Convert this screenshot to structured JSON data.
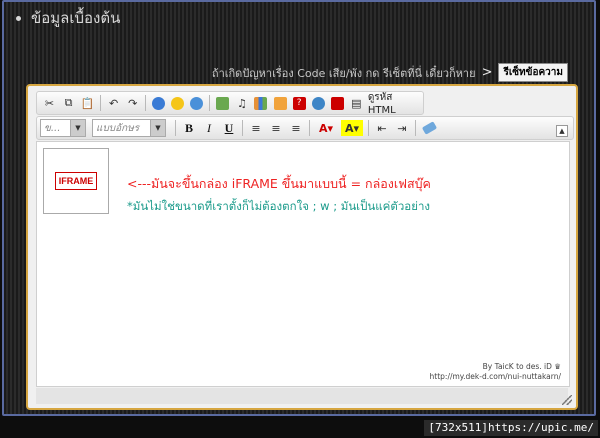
{
  "section_heading": "ข้อมูลเบื้องต้น",
  "help": {
    "text": "ถ้าเกิดปัญหาเรื่อง Code เสีย/พัง กด รีเซ็ตที่นี่ เดี๋ยวก็หาย",
    "arrow": ">",
    "reset_label": "รีเซ็ทข้อความ"
  },
  "toolbar": {
    "source_label": "ดูรหัส HTML",
    "size_placeholder": "ข...",
    "font_placeholder": "แบบอักษร",
    "bold": "B",
    "italic": "I",
    "underline": "U"
  },
  "content": {
    "iframe_label": "IFRAME",
    "line1": "<---มันจะขึ้นกล่อง iFRAME ขึ้นมาแบบนี้ = กล่องเฟสบุ๊ค",
    "line2": "*มันไม่ใช่ขนาดที่เราตั้งก็ไม่ต้องตกใจ ; w ; มันเป็นแค่ตัวอย่าง",
    "credit_line1": "By TaicK to des. iD ♛",
    "credit_line2": "http://my.dek-d.com/nui-nuttakarn/"
  },
  "watermark": "[732x511]https://upic.me/",
  "colors": {
    "editor_border": "#d6a640",
    "message_red": "#ee2222",
    "message_teal": "#1a9a8a"
  }
}
